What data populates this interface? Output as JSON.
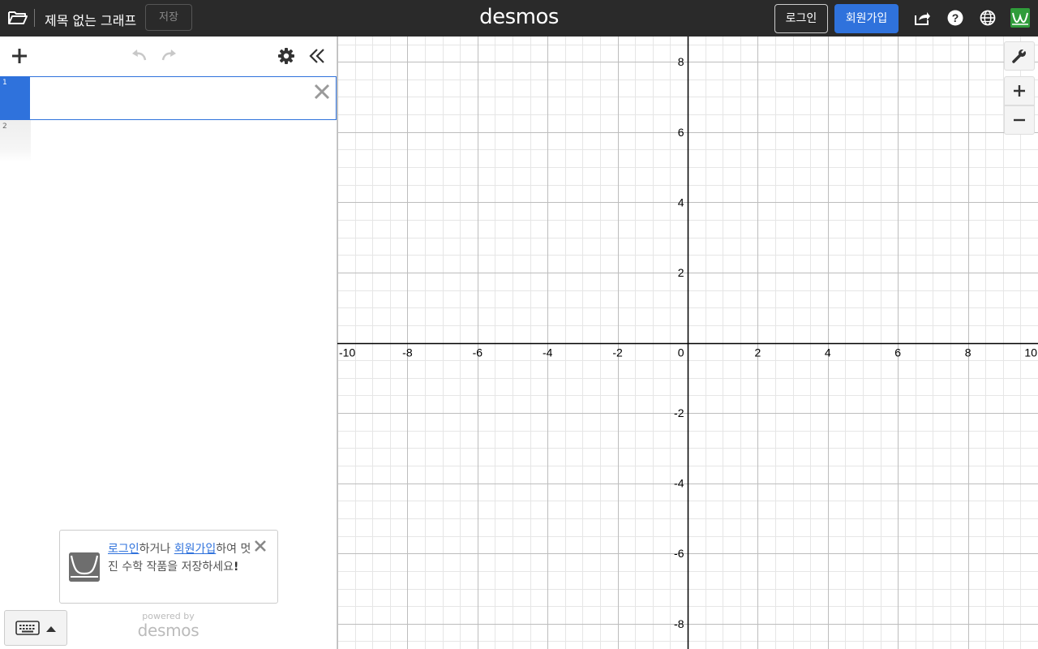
{
  "header": {
    "graph_title": "제목 없는 그래프",
    "save_label": "저장",
    "logo_text": "desmos",
    "login_label": "로그인",
    "signup_label": "회원가입",
    "icons": [
      "folder-icon",
      "share-icon",
      "help-icon",
      "globe-icon",
      "user-avatar-icon"
    ]
  },
  "toolbar": {
    "icons": [
      "add-item-icon",
      "undo-icon",
      "redo-icon",
      "settings-gear-icon",
      "collapse-panel-icon"
    ]
  },
  "expressions": [
    {
      "number": "1",
      "value": "",
      "active": true
    },
    {
      "number": "2",
      "value": "",
      "active": false
    }
  ],
  "login_prompt": {
    "login_link": "로그인",
    "middle_text": "하거나 ",
    "signup_link": "회원가입",
    "rest_text": "하여 멋진 수학 작품을 저장하세요",
    "exclamation": "!"
  },
  "footer": {
    "powered_by": "powered by",
    "powered_logo": "desmos"
  },
  "graph": {
    "x_range": [
      -10,
      10
    ],
    "y_range": [
      -8.72,
      8.72
    ],
    "grid": true,
    "x_tick_labels": [
      "-10",
      "-8",
      "-6",
      "-4",
      "-2",
      "0",
      "2",
      "4",
      "6",
      "8",
      "10"
    ],
    "y_tick_labels": [
      "8",
      "6",
      "4",
      "2",
      "-2",
      "-4",
      "-6",
      "-8"
    ],
    "controls": [
      "wrench-icon",
      "zoom-in-icon",
      "zoom-out-icon"
    ]
  },
  "colors": {
    "header_bg": "#2a2a2a",
    "accent_blue": "#2f72dc",
    "grid_minor": "#e6e6e6",
    "grid_major": "#bdbdbd",
    "axis": "#000000"
  }
}
